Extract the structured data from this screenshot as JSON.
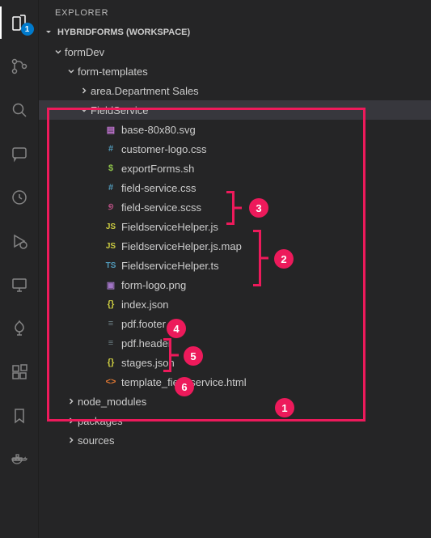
{
  "sidebar": {
    "title": "EXPLORER"
  },
  "section": {
    "title": "HYBRIDFORMS (WORKSPACE)"
  },
  "tree": {
    "formDev": "formDev",
    "formTemplates": "form-templates",
    "areaDept": "area.Department Sales",
    "fieldService": "FieldService",
    "files": [
      "base-80x80.svg",
      "customer-logo.css",
      "exportForms.sh",
      "field-service.css",
      "field-service.scss",
      "FieldserviceHelper.js",
      "FieldserviceHelper.js.map",
      "FieldserviceHelper.ts",
      "form-logo.png",
      "index.json",
      "pdf.footer",
      "pdf.header",
      "stages.json",
      "template_field-service.html"
    ],
    "nodeModules": "node_modules",
    "packages": "packages",
    "sources": "sources"
  },
  "activity": {
    "explorerBadge": "1"
  },
  "annotations": {
    "n1": "1",
    "n2": "2",
    "n3": "3",
    "n4": "4",
    "n5": "5",
    "n6": "6"
  }
}
